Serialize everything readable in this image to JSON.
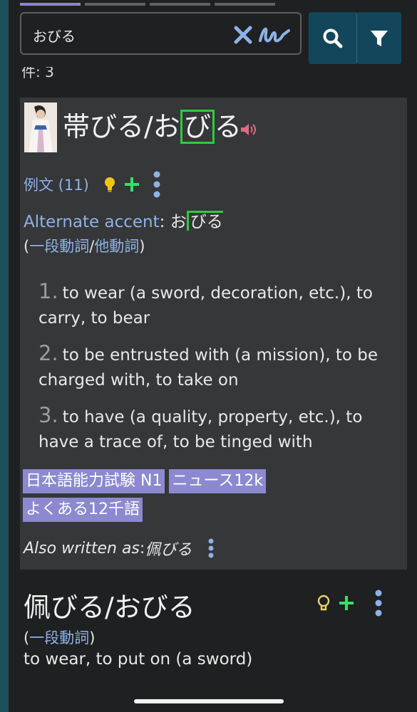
{
  "tabs": [
    "",
    "",
    "",
    ""
  ],
  "search": {
    "value": "おびる",
    "placeholder": ""
  },
  "result_count": "件: 3",
  "entry1": {
    "headword_kanji": "帯びる/お",
    "headword_accent": "び",
    "headword_rest": "る",
    "examples_label": "例文 (11)",
    "alt_accent_label": "Alternate accent",
    "alt_accent_sep": ": ",
    "alt_accent_pre": "お",
    "alt_accent_mark": "びる",
    "pos_open": "(",
    "pos_1": "一段動詞",
    "pos_sep": "/",
    "pos_2": "他動詞",
    "pos_close": ")",
    "senses": [
      {
        "num": "1.",
        "text": "to wear (a sword, decoration, etc.), to carry, to bear"
      },
      {
        "num": "2.",
        "text": "to be entrusted with (a mission), to be charged with, to take on"
      },
      {
        "num": "3.",
        "text": "to have (a quality, property, etc.), to have a trace of, to be tinged with"
      }
    ],
    "tags": [
      "日本語能力試験 N1",
      "ニュース12k",
      "よくある12千語"
    ],
    "also_label": "Also written as",
    "also_sep": ": ",
    "also_value": "佩びる"
  },
  "entry2": {
    "headword": "佩びる/おびる",
    "pos_open": "(",
    "pos_1": "一段動詞",
    "pos_close": ")",
    "gloss": "to wear, to put on (a sword)"
  },
  "colors": {
    "accent_blue": "#8eb2e8",
    "tag_purple": "#8c89d0",
    "pitch_green": "#2ecc40",
    "button_teal": "#13465a"
  }
}
